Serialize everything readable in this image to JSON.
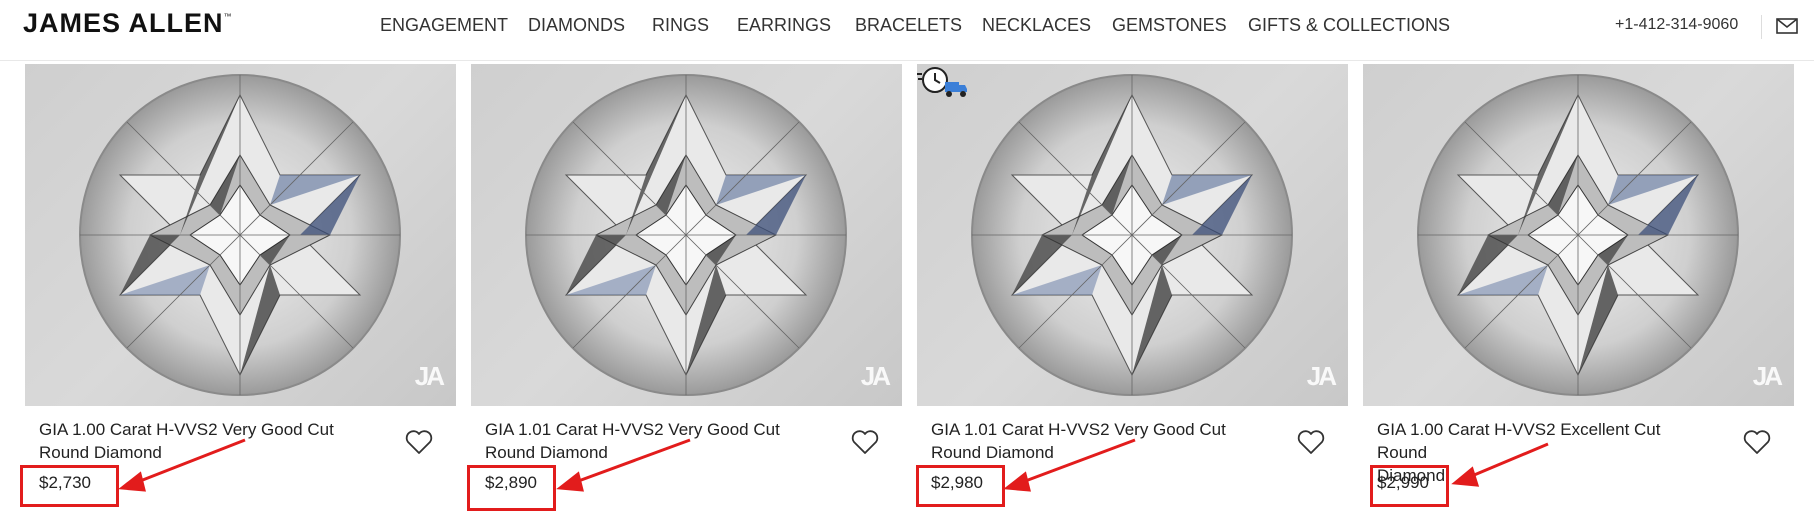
{
  "brand": {
    "logo": "JAMES ALLEN",
    "logo_mark": "™"
  },
  "nav": {
    "items": [
      {
        "label": "ENGAGEMENT"
      },
      {
        "label": "DIAMONDS"
      },
      {
        "label": "RINGS"
      },
      {
        "label": "EARRINGS"
      },
      {
        "label": "BRACELETS"
      },
      {
        "label": "NECKLACES"
      },
      {
        "label": "GEMSTONES"
      },
      {
        "label": "GIFTS & COLLECTIONS"
      }
    ]
  },
  "contact": {
    "phone": "+1-412-314-9060",
    "mail_icon": "mail-icon"
  },
  "products": [
    {
      "title_line1": "GIA 1.00 Carat H-VVS2 Very Good Cut",
      "title_line2": "Round Diamond",
      "price": "$2,730",
      "watermark": "JA",
      "fast_shipping": false
    },
    {
      "title_line1": "GIA 1.01 Carat H-VVS2 Very Good Cut",
      "title_line2": "Round Diamond",
      "price": "$2,890",
      "watermark": "JA",
      "fast_shipping": false
    },
    {
      "title_line1": "GIA 1.01 Carat H-VVS2 Very Good Cut",
      "title_line2": "Round Diamond",
      "price": "$2,980",
      "watermark": "JA",
      "fast_shipping": true
    },
    {
      "title_line1": "GIA 1.00 Carat H-VVS2 Excellent Cut Round",
      "title_line2": "Diamond",
      "price": "$2,990",
      "watermark": "JA",
      "fast_shipping": false
    }
  ],
  "colors": {
    "annotation_red": "#e21c1c",
    "image_bg": "#d3d3d3"
  }
}
